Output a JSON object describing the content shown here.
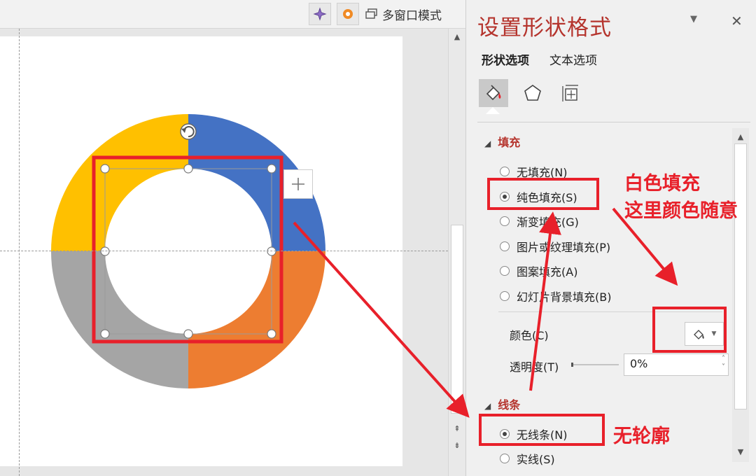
{
  "toolbar": {
    "multi_window_label": "多窗口模式",
    "icons": [
      "sparkle-icon",
      "flower-icon",
      "window-icon"
    ]
  },
  "pane": {
    "title": "设置形状格式",
    "tabs": [
      {
        "label": "形状选项",
        "active": true
      },
      {
        "label": "文本选项",
        "active": false
      }
    ],
    "icon_buttons": [
      "fill-line-icon",
      "effects-pentagon-icon",
      "size-properties-icon"
    ],
    "fill_section": {
      "title": "填充",
      "options": [
        {
          "label": "无填充(N)",
          "selected": false
        },
        {
          "label": "纯色填充(S)",
          "selected": true
        },
        {
          "label": "渐变填充(G)",
          "selected": false
        },
        {
          "label": "图片或纹理填充(P)",
          "selected": false
        },
        {
          "label": "图案填充(A)",
          "selected": false
        },
        {
          "label": "幻灯片背景填充(B)",
          "selected": false
        }
      ],
      "color_label": "颜色(C)",
      "transparency_label": "透明度(T)",
      "transparency_value": "0%"
    },
    "line_section": {
      "title": "线条",
      "options": [
        {
          "label": "无线条(N)",
          "selected": true
        },
        {
          "label": "实线(S)",
          "selected": false
        }
      ]
    }
  },
  "annotations": {
    "white_fill": "白色填充",
    "any_color": "这里颜色随意",
    "no_outline": "无轮廓"
  },
  "colors": {
    "yellow": "#FFC000",
    "blue": "#4472C4",
    "orange": "#ED7D31",
    "gray": "#A5A5A5",
    "annotation_red": "#E8202A",
    "pane_title": "#B5342D"
  }
}
